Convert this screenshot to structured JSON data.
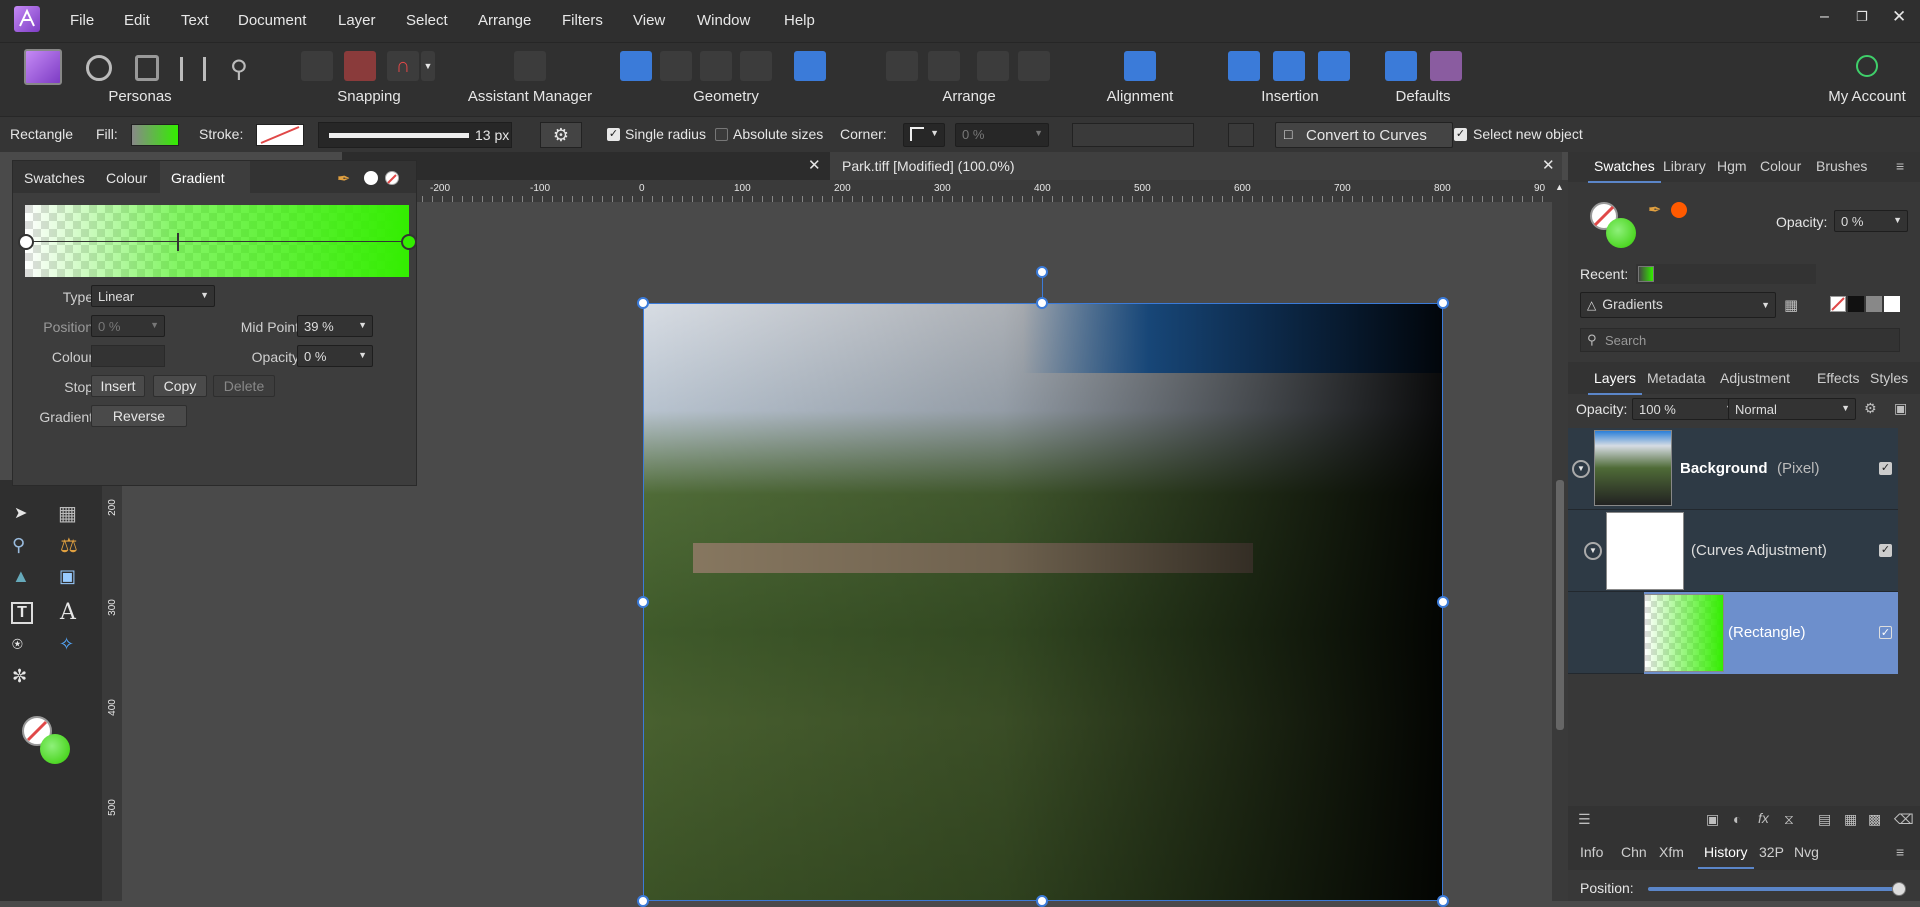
{
  "menubar": {
    "items": [
      "File",
      "Edit",
      "Text",
      "Document",
      "Layer",
      "Select",
      "Arrange",
      "Filters",
      "View",
      "Window",
      "Help"
    ]
  },
  "toolbar": {
    "groups": {
      "personas": "Personas",
      "snapping": "Snapping",
      "assistant": "Assistant Manager",
      "geometry": "Geometry",
      "arrange": "Arrange",
      "alignment": "Alignment",
      "insertion": "Insertion",
      "defaults": "Defaults",
      "account": "My Account"
    }
  },
  "context": {
    "tool": "Rectangle",
    "fill_label": "Fill:",
    "stroke_label": "Stroke:",
    "stroke_width": "13 px",
    "single_radius": "Single radius",
    "absolute_sizes": "Absolute sizes",
    "corner_label": "Corner:",
    "corner_value": "0 %",
    "convert": "Convert to Curves",
    "select_new": "Select new object"
  },
  "gradient_panel": {
    "tabs": [
      "Swatches",
      "Colour",
      "Gradient"
    ],
    "type_label": "Type:",
    "type_value": "Linear",
    "position_label": "Position:",
    "position_value": "0 %",
    "midpoint_label": "Mid Point:",
    "midpoint_value": "39 %",
    "colour_label": "Colour:",
    "opacity_label": "Opacity:",
    "opacity_value": "0 %",
    "stop_label": "Stop:",
    "insert": "Insert",
    "copy": "Copy",
    "delete": "Delete",
    "gradient_label": "Gradient:",
    "reverse": "Reverse",
    "end_color": "#33ee00"
  },
  "document": {
    "tab_title": "Park.tiff [Modified] (100.0%)",
    "ruler_h": [
      "-200",
      "-100",
      "0",
      "100",
      "200",
      "300",
      "400",
      "500",
      "600",
      "700",
      "800",
      "90"
    ],
    "ruler_v": [
      "200",
      "300",
      "400",
      "500"
    ]
  },
  "right_panel": {
    "top_tabs": [
      "Swatches",
      "Library",
      "Hgm",
      "Colour",
      "Brushes"
    ],
    "opacity_label": "Opacity:",
    "opacity_value": "0 %",
    "recent_label": "Recent:",
    "palette": "Gradients",
    "search_placeholder": "Search",
    "layer_tabs": [
      "Layers",
      "Metadata",
      "Adjustment",
      "Effects",
      "Styles"
    ],
    "layers_opacity_label": "Opacity:",
    "layers_opacity_value": "100 %",
    "blend_mode": "Normal",
    "layers": [
      {
        "name": "Background",
        "type": "(Pixel)"
      },
      {
        "name": "",
        "type": "(Curves Adjustment)"
      },
      {
        "name": "",
        "type": "(Rectangle)"
      }
    ],
    "bottom_tabs": [
      "Info",
      "Chn",
      "Xfm",
      "History",
      "32P",
      "Nvg"
    ],
    "position_label": "Position:",
    "history_position": 1.0
  },
  "colors": {
    "accent": "#5b86c9",
    "selected_layer": "#6d8fcc",
    "handle": "#3b7bd9"
  }
}
